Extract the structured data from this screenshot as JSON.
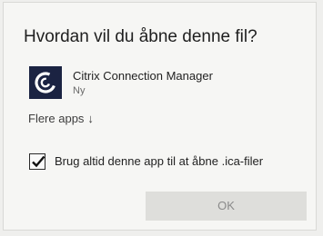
{
  "dialog": {
    "title": "Hvordan vil du åbne denne fil?",
    "app": {
      "name": "Citrix Connection Manager",
      "subtitle": "Ny",
      "icon": "citrix-icon",
      "icon_bg": "#1b2342"
    },
    "more_apps_label": "Flere apps",
    "more_apps_arrow": "↓",
    "always_use": {
      "label": "Brug altid denne app til at åbne .ica-filer",
      "checked": true
    },
    "ok_label": "OK"
  }
}
